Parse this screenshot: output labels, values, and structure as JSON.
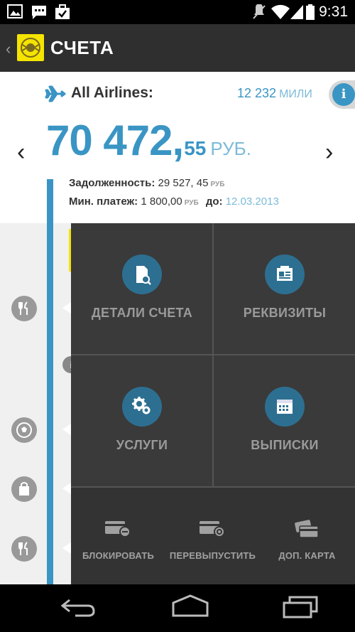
{
  "status_bar": {
    "time": "9:31",
    "icons": [
      "image-icon",
      "message-icon",
      "check-bag-icon",
      "mute-icon",
      "wifi-icon",
      "cell-signal-icon",
      "battery-icon"
    ]
  },
  "action_bar": {
    "title": "СЧЕТА",
    "back_glyph": "‹"
  },
  "account": {
    "program_name": "All Airlines:",
    "miles_value": "12 232",
    "miles_unit": "МИЛИ",
    "info_glyph": "i",
    "balance_int": "70 472",
    "balance_comma": ",",
    "balance_frac": "55",
    "balance_currency": "РУБ.",
    "debt_label": "Задолженность:",
    "debt_value": "29 527, 45",
    "debt_currency": "РУБ",
    "min_payment_label": "Мин. платеж:",
    "min_payment_value": "1 800,00",
    "min_payment_currency": "РУБ",
    "due_label": "до:",
    "due_date": "12.03.2013",
    "prev_glyph": "‹",
    "next_glyph": "›"
  },
  "menu": {
    "tiles": [
      {
        "label": "ДЕТАЛИ СЧЕТА",
        "icon": "document-search-icon"
      },
      {
        "label": "РЕКВИЗИТЫ",
        "icon": "id-card-icon"
      },
      {
        "label": "УСЛУГИ",
        "icon": "gears-icon"
      },
      {
        "label": "ВЫПИСКИ",
        "icon": "calendar-icon"
      }
    ],
    "actions": [
      {
        "label": "БЛОКИРОВАТЬ",
        "icon": "card-block-icon"
      },
      {
        "label": "ПЕРЕВЫПУСТИТЬ",
        "icon": "card-reissue-icon"
      },
      {
        "label": "ДОП. КАРТА",
        "icon": "extra-card-icon"
      }
    ]
  },
  "timeline": {
    "icons": [
      "restaurant-icon",
      "info-icon",
      "football-icon",
      "shopping-bag-icon",
      "restaurant-icon"
    ]
  },
  "colors": {
    "accent": "#3a95c4",
    "accent_light": "#7cbbd8",
    "overlay": "#3a3a3a",
    "tile_circle": "#2d6f91",
    "logo_yellow": "#f5e400"
  }
}
